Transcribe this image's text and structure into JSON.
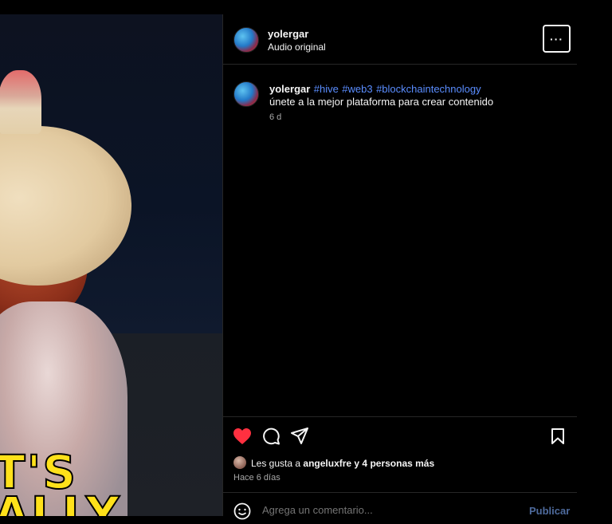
{
  "video": {
    "caption_line_1": "T'S",
    "caption_line_2": "ALLY",
    "mute_icon": "speaker-muted-icon"
  },
  "header": {
    "username": "yolergar",
    "audio": "Audio original",
    "more_label": "···"
  },
  "post": {
    "username": "yolergar",
    "hashtags": [
      "#hive",
      "#web3",
      "#blockchaintechnology"
    ],
    "text": "únete a la mejor plataforma para crear contenido",
    "time": "6 d"
  },
  "actions": {
    "like_icon": "heart-filled-icon",
    "comment_icon": "comment-icon",
    "share_icon": "send-icon",
    "save_icon": "bookmark-icon",
    "like_color": "#ff3040"
  },
  "likes": {
    "prefix": "Les gusta a",
    "user": "angeluxfre",
    "suffix": "y 4 personas más"
  },
  "posted_ago": "Hace 6 días",
  "comment": {
    "emoji_icon": "smiley-icon",
    "placeholder": "Agrega un comentario...",
    "publish_label": "Publicar"
  }
}
